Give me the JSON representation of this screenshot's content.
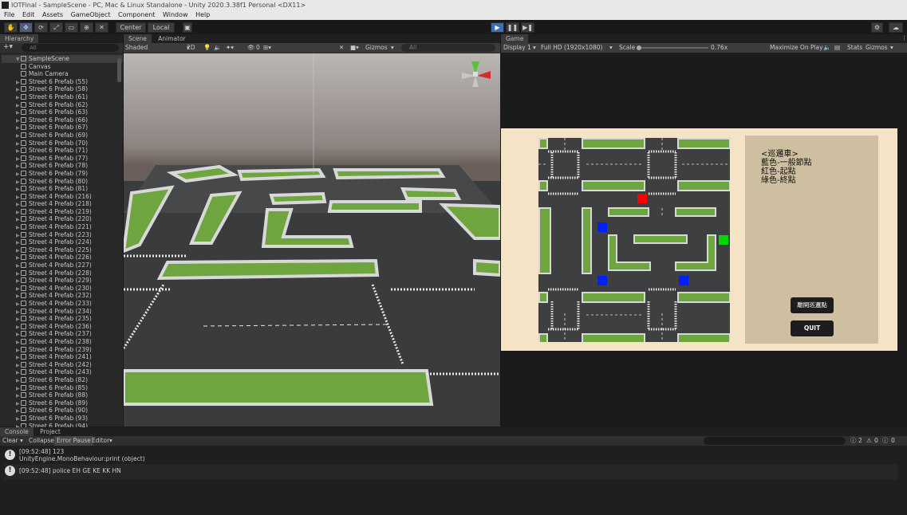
{
  "window": {
    "title": "IOTFinal - SampleScene - PC, Mac & Linux Standalone - Unity 2020.3.38f1 Personal <DX11>"
  },
  "menu": [
    "File",
    "Edit",
    "Assets",
    "GameObject",
    "Component",
    "Window",
    "Help"
  ],
  "toolbar": {
    "center_label": "Center",
    "local_label": "Local",
    "play_icon": "play-icon",
    "pause_icon": "pause-icon",
    "step_icon": "step-icon"
  },
  "hierarchy": {
    "tab": "Hierarchy",
    "search_placeholder": "All",
    "scene": "SampleScene",
    "items": [
      "Canvas",
      "Main Camera",
      "Street 6 Prefab (55)",
      "Street 6 Prefab (58)",
      "Street 6 Prefab (61)",
      "Street 6 Prefab (62)",
      "Street 6 Prefab (63)",
      "Street 6 Prefab (66)",
      "Street 6 Prefab (67)",
      "Street 6 Prefab (69)",
      "Street 6 Prefab (70)",
      "Street 6 Prefab (71)",
      "Street 6 Prefab (77)",
      "Street 6 Prefab (78)",
      "Street 6 Prefab (79)",
      "Street 6 Prefab (80)",
      "Street 6 Prefab (81)",
      "Street 4 Prefab (216)",
      "Street 4 Prefab (218)",
      "Street 4 Prefab (219)",
      "Street 4 Prefab (220)",
      "Street 4 Prefab (221)",
      "Street 4 Prefab (223)",
      "Street 4 Prefab (224)",
      "Street 4 Prefab (225)",
      "Street 4 Prefab (226)",
      "Street 4 Prefab (227)",
      "Street 4 Prefab (228)",
      "Street 4 Prefab (229)",
      "Street 4 Prefab (230)",
      "Street 4 Prefab (232)",
      "Street 4 Prefab (233)",
      "Street 4 Prefab (234)",
      "Street 4 Prefab (235)",
      "Street 4 Prefab (236)",
      "Street 4 Prefab (237)",
      "Street 4 Prefab (238)",
      "Street 4 Prefab (239)",
      "Street 4 Prefab (241)",
      "Street 4 Prefab (242)",
      "Street 4 Prefab (243)",
      "Street 6 Prefab (82)",
      "Street 6 Prefab (85)",
      "Street 6 Prefab (88)",
      "Street 6 Prefab (89)",
      "Street 6 Prefab (90)",
      "Street 6 Prefab (93)",
      "Street 6 Prefab (94)"
    ]
  },
  "scene_view": {
    "tabs": [
      "Scene",
      "Animator"
    ],
    "shading": "Shaded",
    "mode_2d": "2D",
    "gizmos": "Gizmos",
    "search_placeholder": "All",
    "vis_count": "0"
  },
  "game_view": {
    "tab": "Game",
    "display": "Display 1",
    "resolution": "Full HD (1920x1080)",
    "scale_label": "Scale",
    "scale_value": "0.76x",
    "maximize": "Maximize On Play",
    "stats": "Stats",
    "gizmos": "Gizmos",
    "legend_lines": [
      "<巡邏車>",
      "藍色-一般節點",
      "紅色-起點",
      "綠色-終點"
    ],
    "btn_exit": "離開巡邏點",
    "btn_quit": "QUIT",
    "colors": {
      "normal": "#0020ff",
      "start": "#ff0000",
      "end": "#00d800"
    }
  },
  "bottom": {
    "tabs": [
      "Console",
      "Project"
    ],
    "clear": "Clear",
    "collapse": "Collapse",
    "error_pause": "Error Pause",
    "editor": "Editor",
    "counts": {
      "log": "2",
      "warn": "0",
      "error": "0"
    },
    "logs": [
      {
        "line1": "[09:52:48] 123",
        "line2": "UnityEngine.MonoBehaviour:print (object)"
      },
      {
        "line1": "[09:52:48] police EH GE KE KK HN",
        "line2": ""
      }
    ]
  }
}
